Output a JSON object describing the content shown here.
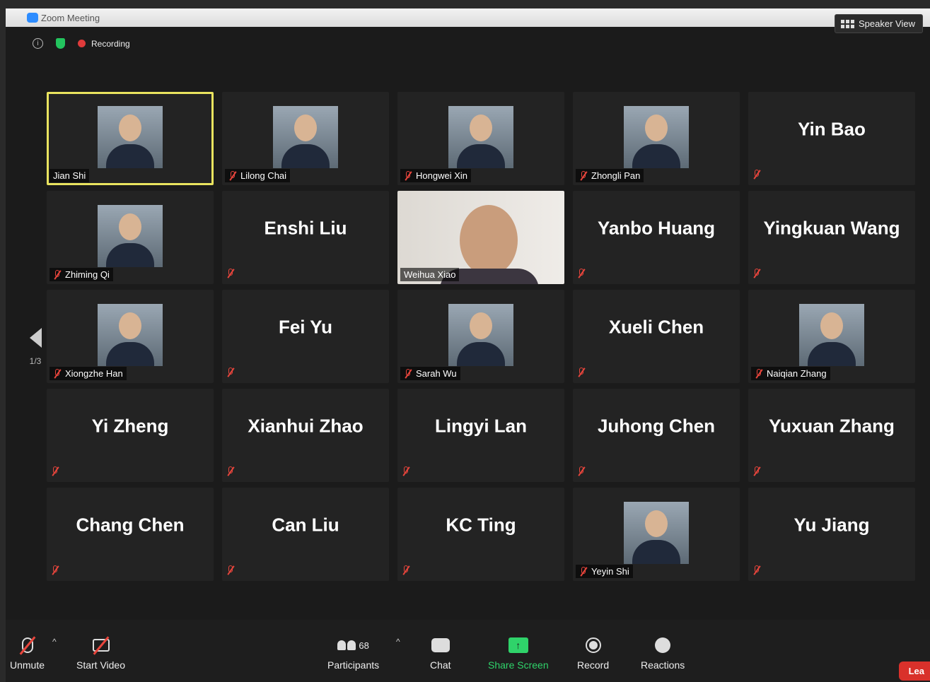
{
  "window": {
    "title": "Zoom Meeting"
  },
  "infobar": {
    "recording_label": "Recording"
  },
  "header": {
    "view_label": "Speaker View"
  },
  "pager": {
    "label": "1/3"
  },
  "tiles": [
    {
      "name": "Jian Shi",
      "mode": "photo",
      "active": true,
      "muted": false
    },
    {
      "name": "Lilong Chai",
      "mode": "photo",
      "muted": true
    },
    {
      "name": "Hongwei Xin",
      "mode": "photo",
      "muted": true
    },
    {
      "name": "Zhongli Pan",
      "mode": "photo",
      "muted": true
    },
    {
      "name": "Yin Bao",
      "mode": "text",
      "muted": true
    },
    {
      "name": "Zhiming Qi",
      "mode": "photo",
      "muted": true
    },
    {
      "name": "Enshi Liu",
      "mode": "text",
      "muted": true
    },
    {
      "name": "Weihua Xiao",
      "mode": "video",
      "muted": false
    },
    {
      "name": "Yanbo Huang",
      "mode": "text",
      "muted": true
    },
    {
      "name": "Yingkuan Wang",
      "mode": "text",
      "muted": true
    },
    {
      "name": "Xiongzhe Han",
      "mode": "photo",
      "muted": true
    },
    {
      "name": "Fei Yu",
      "mode": "text",
      "muted": true
    },
    {
      "name": "Sarah Wu",
      "mode": "photo",
      "muted": true
    },
    {
      "name": "Xueli Chen",
      "mode": "text",
      "muted": true
    },
    {
      "name": "Naiqian Zhang",
      "mode": "photo",
      "muted": true
    },
    {
      "name": "Yi Zheng",
      "mode": "text",
      "muted": true
    },
    {
      "name": "Xianhui Zhao",
      "mode": "text",
      "muted": true
    },
    {
      "name": "Lingyi Lan",
      "mode": "text",
      "muted": true
    },
    {
      "name": "Juhong Chen",
      "mode": "text",
      "muted": true
    },
    {
      "name": "Yuxuan Zhang",
      "mode": "text",
      "muted": true
    },
    {
      "name": "Chang Chen",
      "mode": "text",
      "muted": true
    },
    {
      "name": "Can Liu",
      "mode": "text",
      "muted": true
    },
    {
      "name": "KC Ting",
      "mode": "text",
      "muted": true
    },
    {
      "name": "Yeyin Shi",
      "mode": "photo",
      "muted": true
    },
    {
      "name": "Yu Jiang",
      "mode": "text",
      "muted": true
    }
  ],
  "toolbar": {
    "unmute_label": "Unmute",
    "start_video_label": "Start Video",
    "participants_label": "Participants",
    "participants_count": "68",
    "chat_label": "Chat",
    "share_label": "Share Screen",
    "record_label": "Record",
    "reactions_label": "Reactions",
    "leave_label": "Lea"
  },
  "colors": {
    "active_speaker": "#e9e35f",
    "share_green": "#2fd36a",
    "recording_red": "#e03b3b",
    "leave_red": "#d9312b"
  }
}
